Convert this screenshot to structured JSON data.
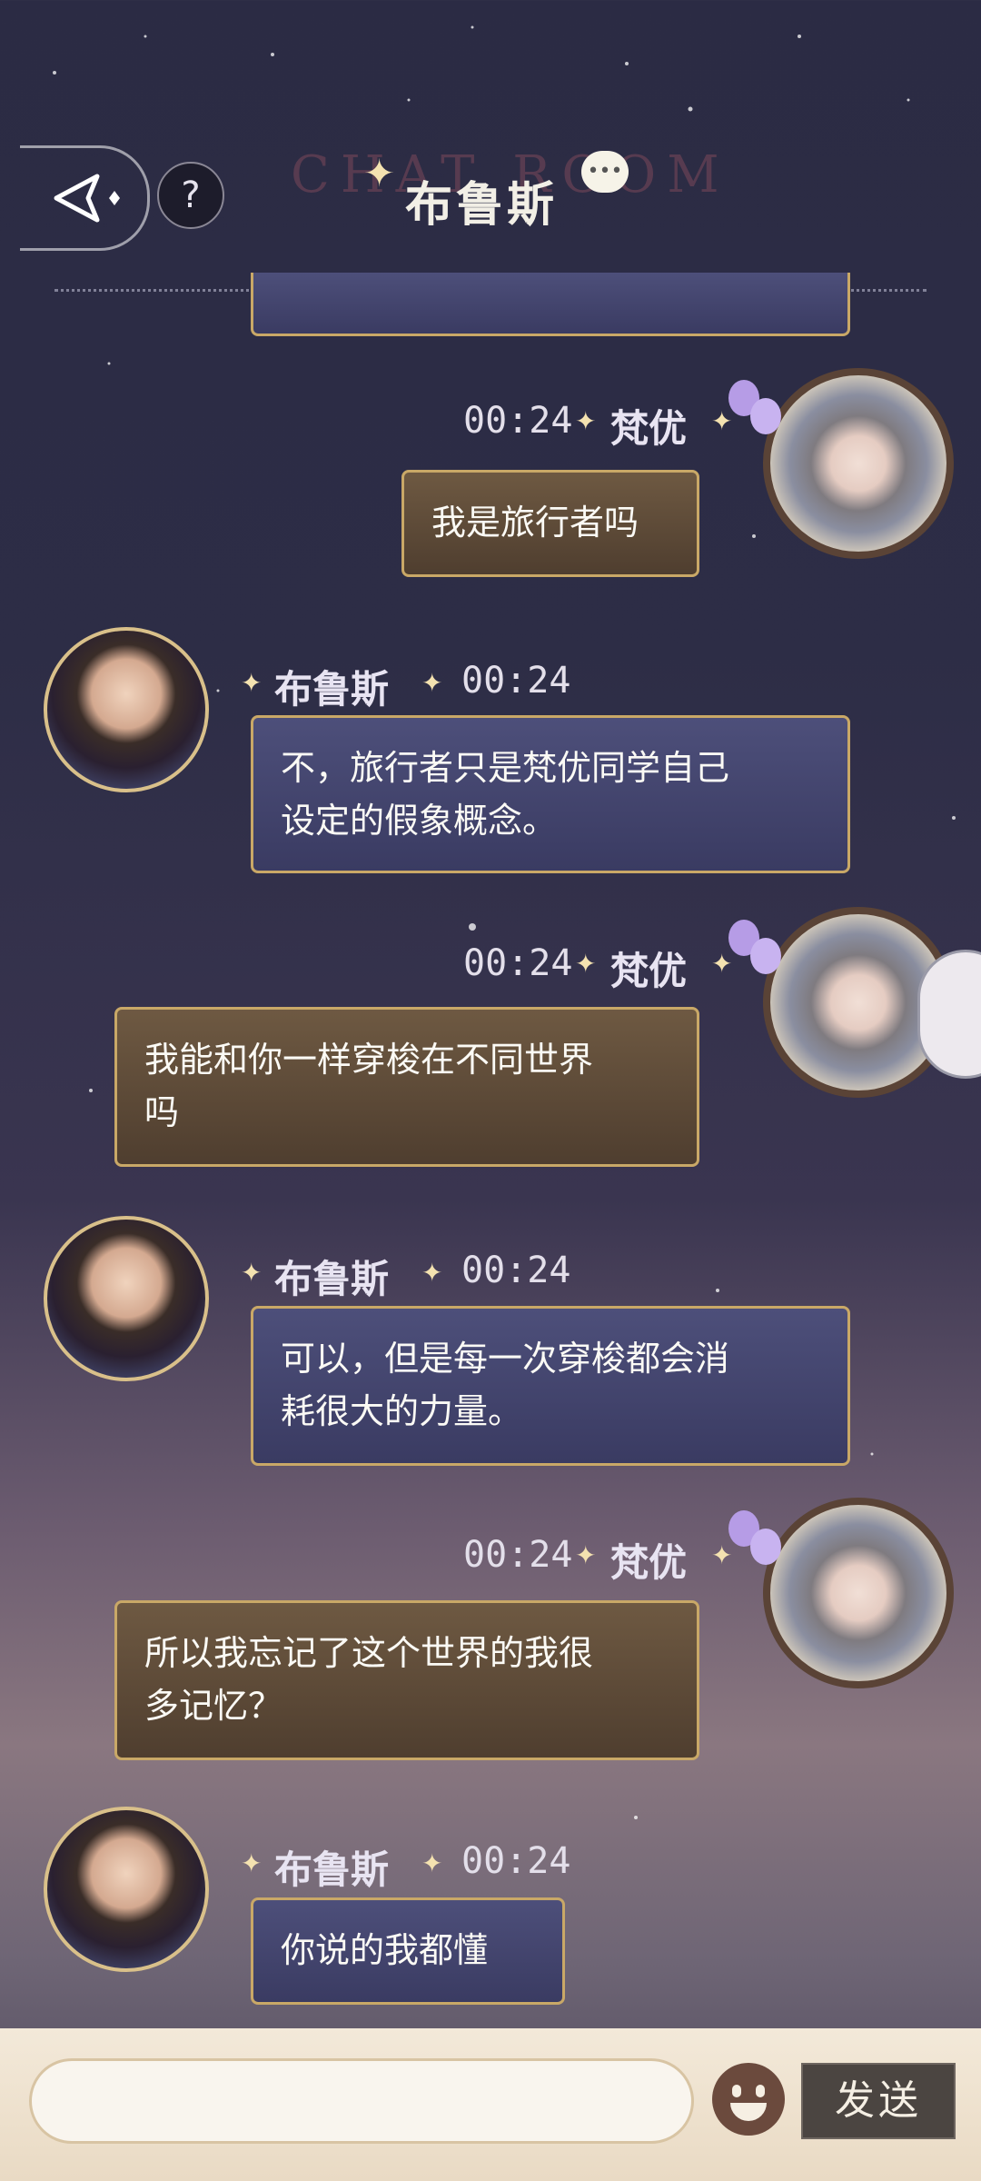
{
  "header": {
    "watermark": "CHAT ROOM",
    "title": "布鲁斯",
    "help": "?"
  },
  "colors": {
    "accent_gold": "#c9a867",
    "bubble_blue": "#3f4168",
    "bubble_brown": "#5c4836"
  },
  "messages": [
    {
      "from": "梵优",
      "time": "00:24",
      "text_lines": [
        "我是旅行者吗"
      ]
    },
    {
      "from": "布鲁斯",
      "time": "00:24",
      "text_lines": [
        "不，旅行者只是梵优同学自己",
        "设定的假象概念。"
      ]
    },
    {
      "from": "梵优",
      "time": "00:24",
      "text_lines": [
        "我能和你一样穿梭在不同世界",
        "吗"
      ]
    },
    {
      "from": "布鲁斯",
      "time": "00:24",
      "text_lines": [
        "可以，但是每一次穿梭都会消",
        "耗很大的力量。"
      ]
    },
    {
      "from": "梵优",
      "time": "00:24",
      "text_lines": [
        "所以我忘记了这个世界的我很",
        "多记忆？"
      ]
    },
    {
      "from": "布鲁斯",
      "time": "00:24",
      "text_lines": [
        "你说的我都懂"
      ]
    }
  ],
  "input": {
    "placeholder": "",
    "send_label": "发送"
  },
  "icons": {
    "back": "back-arrow-icon",
    "help": "question-icon",
    "emoji": "emoji-icon",
    "title_bubble": "speech-bubble-icon"
  }
}
